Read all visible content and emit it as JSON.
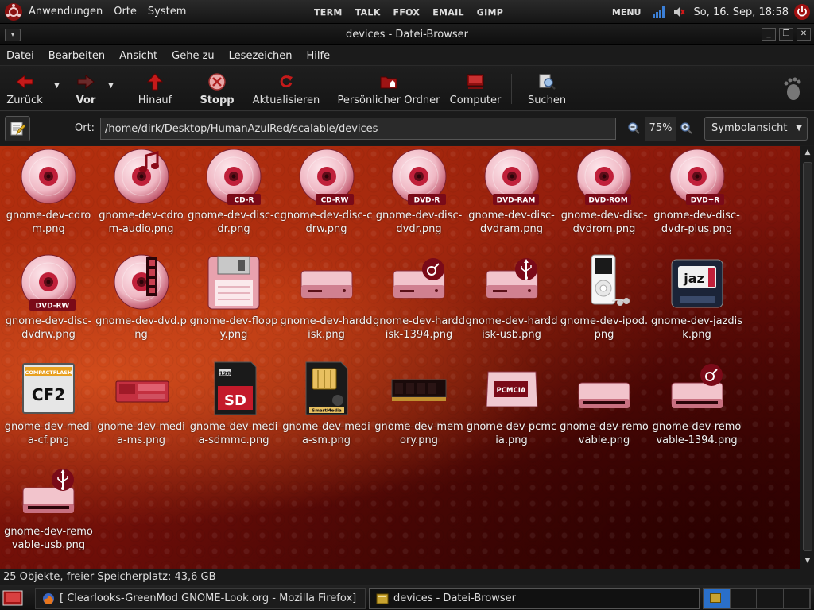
{
  "top_panel": {
    "menus": [
      "Anwendungen",
      "Orte",
      "System"
    ],
    "launchers": [
      "TERM",
      "TALK",
      "FFOX",
      "EMAIL",
      "GIMP"
    ],
    "menu_label": "MENU",
    "clock": "So, 16. Sep, 18:58"
  },
  "window": {
    "title": "devices - Datei-Browser"
  },
  "menubar": [
    "Datei",
    "Bearbeiten",
    "Ansicht",
    "Gehe zu",
    "Lesezeichen",
    "Hilfe"
  ],
  "toolbar": {
    "back": "Zurück",
    "forward": "Vor",
    "up": "Hinauf",
    "stop": "Stopp",
    "reload": "Aktualisieren",
    "home": "Persönlicher Ordner",
    "computer": "Computer",
    "search": "Suchen"
  },
  "location": {
    "label": "Ort:",
    "path": "/home/dirk/Desktop/HumanAzulRed/scalable/devices",
    "zoom": "75%",
    "view_mode": "Symbolansicht"
  },
  "files": [
    {
      "name": "gnome-dev-cdrom.png",
      "icon": "disc-icon",
      "badge": ""
    },
    {
      "name": "gnome-dev-cdrom-audio.png",
      "icon": "disc-audio-icon",
      "badge": ""
    },
    {
      "name": "gnome-dev-disc-cdr.png",
      "icon": "disc-icon",
      "badge": "CD-R"
    },
    {
      "name": "gnome-dev-disc-cdrw.png",
      "icon": "disc-icon",
      "badge": "CD-RW"
    },
    {
      "name": "gnome-dev-disc-dvdr.png",
      "icon": "disc-icon",
      "badge": "DVD-R"
    },
    {
      "name": "gnome-dev-disc-dvdram.png",
      "icon": "disc-icon",
      "badge": "DVD-RAM"
    },
    {
      "name": "gnome-dev-disc-dvdrom.png",
      "icon": "disc-icon",
      "badge": "DVD-ROM"
    },
    {
      "name": "gnome-dev-disc-dvdr-plus.png",
      "icon": "disc-icon",
      "badge": "DVD+R"
    },
    {
      "name": "gnome-dev-disc-dvdrw.png",
      "icon": "disc-icon",
      "badge": "DVD-RW"
    },
    {
      "name": "gnome-dev-dvd.png",
      "icon": "disc-film-icon",
      "badge": ""
    },
    {
      "name": "gnome-dev-floppy.png",
      "icon": "floppy-icon",
      "badge": ""
    },
    {
      "name": "gnome-dev-harddisk.png",
      "icon": "harddisk-icon",
      "badge": ""
    },
    {
      "name": "gnome-dev-harddisk-1394.png",
      "icon": "harddisk-firewire-icon",
      "badge": ""
    },
    {
      "name": "gnome-dev-harddisk-usb.png",
      "icon": "harddisk-usb-icon",
      "badge": ""
    },
    {
      "name": "gnome-dev-ipod.png",
      "icon": "ipod-icon",
      "badge": ""
    },
    {
      "name": "gnome-dev-jazdisk.png",
      "icon": "jazdisk-icon",
      "badge": "jaz"
    },
    {
      "name": "gnome-dev-media-cf.png",
      "icon": "compactflash-icon",
      "badge": "CF2",
      "sub": "COMPACTFLASH"
    },
    {
      "name": "gnome-dev-media-ms.png",
      "icon": "memorystick-icon",
      "badge": ""
    },
    {
      "name": "gnome-dev-media-sdmmc.png",
      "icon": "sdcard-icon",
      "badge": "SD",
      "sub": "128"
    },
    {
      "name": "gnome-dev-media-sm.png",
      "icon": "smartmedia-icon",
      "badge": "SmartMedia"
    },
    {
      "name": "gnome-dev-memory.png",
      "icon": "memory-icon",
      "badge": ""
    },
    {
      "name": "gnome-dev-pcmcia.png",
      "icon": "pcmcia-icon",
      "badge": "PCMCIA"
    },
    {
      "name": "gnome-dev-removable.png",
      "icon": "removable-icon",
      "badge": ""
    },
    {
      "name": "gnome-dev-removable-1394.png",
      "icon": "removable-firewire-icon",
      "badge": ""
    },
    {
      "name": "gnome-dev-removable-usb.png",
      "icon": "removable-usb-icon",
      "badge": ""
    }
  ],
  "status": "25 Objekte, freier Speicherplatz: 43,6 GB",
  "taskbar": {
    "tasks": [
      "[ Clearlooks-GreenMod  GNOME-Look.org  -  Mozilla  Firefox]",
      "devices  -  Datei-Browser"
    ]
  },
  "colors": {
    "accent_red": "#d01830",
    "disc_pink": "#f0b8c4",
    "workspace_active": "#2a6fc9"
  }
}
